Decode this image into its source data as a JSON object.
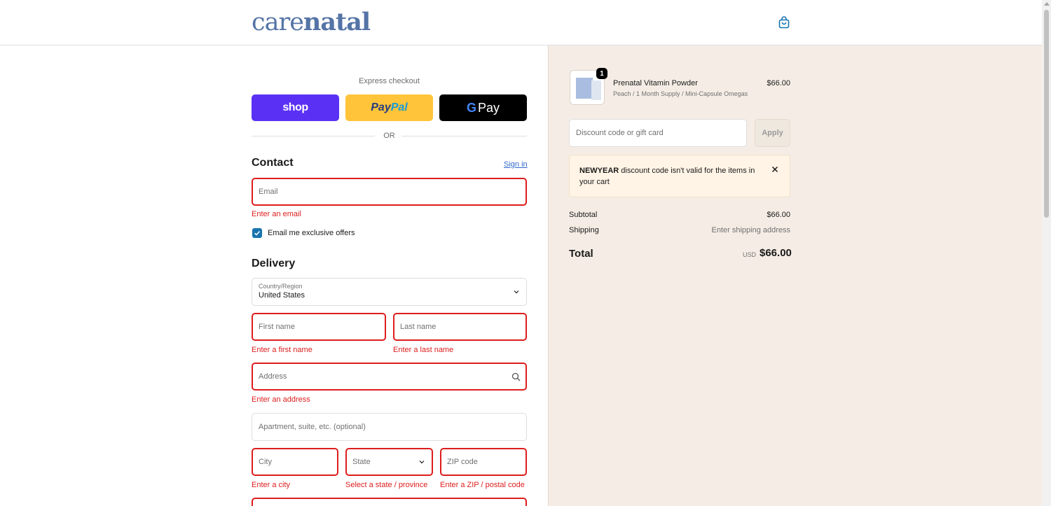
{
  "header": {
    "logo_part1": "care",
    "logo_part2": "natal",
    "cart_icon": "shopping-bag-icon"
  },
  "express": {
    "label": "Express checkout",
    "shop_label": "shop",
    "paypal_label_1": "Pay",
    "paypal_label_2": "Pal",
    "gpay_g": "G",
    "gpay_label": "Pay",
    "or_label": "OR"
  },
  "contact": {
    "title": "Contact",
    "signin_label": "Sign in",
    "email_placeholder": "Email",
    "email_error": "Enter an email",
    "offers_label": "Email me exclusive offers",
    "offers_checked": true
  },
  "delivery": {
    "title": "Delivery",
    "country_label": "Country/Region",
    "country_value": "United States",
    "first_name_placeholder": "First name",
    "first_name_error": "Enter a first name",
    "last_name_placeholder": "Last name",
    "last_name_error": "Enter a last name",
    "address_placeholder": "Address",
    "address_error": "Enter an address",
    "apartment_placeholder": "Apartment, suite, etc. (optional)",
    "city_placeholder": "City",
    "city_error": "Enter a city",
    "state_placeholder": "State",
    "state_error": "Select a state / province",
    "zip_placeholder": "ZIP code",
    "zip_error": "Enter a ZIP / postal code"
  },
  "summary": {
    "product": {
      "name": "Prenatal Vitamin Powder",
      "variant": "Peach / 1 Month Supply / Mini-Capsule Omegas",
      "price": "$66.00",
      "quantity": "1"
    },
    "discount_placeholder": "Discount code or gift card",
    "apply_label": "Apply",
    "notice_code": "NEWYEAR",
    "notice_text": " discount code isn't valid for the items in your cart",
    "subtotal_label": "Subtotal",
    "subtotal_value": "$66.00",
    "shipping_label": "Shipping",
    "shipping_value": "Enter shipping address",
    "total_label": "Total",
    "total_currency": "USD",
    "total_value": "$66.00"
  },
  "colors": {
    "brand": "#5574a6",
    "error": "#dd1d1d",
    "link": "#2f69c8",
    "summary_bg": "#f5ede5",
    "shop_pay": "#5a31f4",
    "paypal": "#ffc439"
  }
}
